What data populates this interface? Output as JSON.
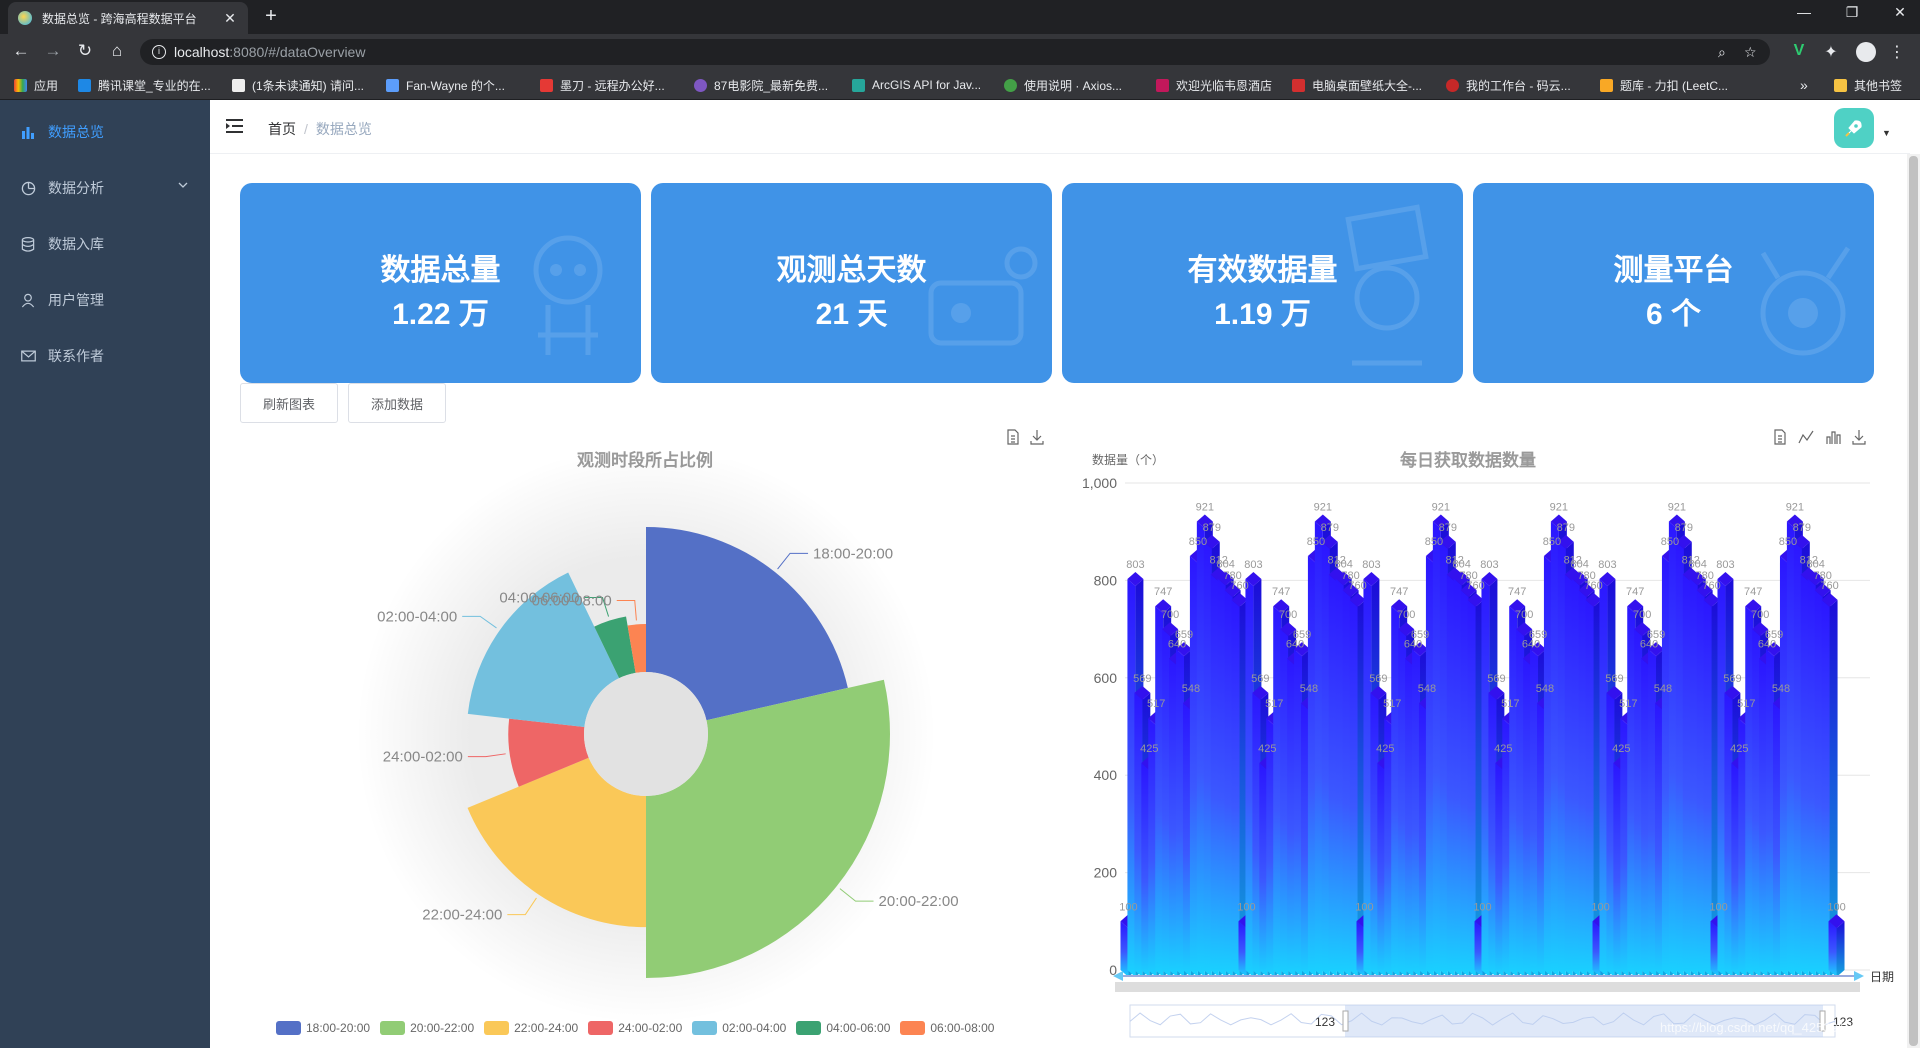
{
  "browser": {
    "tab_title": "数据总览 - 跨海高程数据平台",
    "tab_close": "✕",
    "new_tab": "+",
    "url_host": "localhost",
    "url_path": ":8080/#/dataOverview",
    "bookmarks": [
      {
        "label": "应用",
        "color": "#ea4335"
      },
      {
        "label": "腾讯课堂_专业的在...",
        "color": "#1e88e5"
      },
      {
        "label": "(1条未读通知) 请问...",
        "color": "#111111"
      },
      {
        "label": "Fan-Wayne 的个...",
        "color": "#5c9dfa"
      },
      {
        "label": "墨刀 - 远程办公好...",
        "color": "#e53935"
      },
      {
        "label": "87电影院_最新免费...",
        "color": "#7e57c2"
      },
      {
        "label": "ArcGIS API for Jav...",
        "color": "#26a69a"
      },
      {
        "label": "使用说明 · Axios...",
        "color": "#43a047"
      },
      {
        "label": "欢迎光临韦恩酒店",
        "color": "#c2185b"
      },
      {
        "label": "电脑桌面壁纸大全-...",
        "color": "#d32f2f"
      },
      {
        "label": "我的工作台 - 码云...",
        "color": "#c62828"
      },
      {
        "label": "题库 - 力扣 (LeetC...",
        "color": "#f9a825"
      }
    ],
    "bookmarks_more": "»",
    "other_bookmarks": "其他书签"
  },
  "sidebar": {
    "items": [
      {
        "label": "数据总览",
        "icon": "bar-chart-icon",
        "active": true
      },
      {
        "label": "数据分析",
        "icon": "pie-chart-icon",
        "has_submenu": true
      },
      {
        "label": "数据入库",
        "icon": "database-icon"
      },
      {
        "label": "用户管理",
        "icon": "user-icon"
      },
      {
        "label": "联系作者",
        "icon": "mail-icon"
      }
    ]
  },
  "breadcrumb": {
    "home": "首页",
    "separator": "/",
    "current": "数据总览"
  },
  "cards": [
    {
      "title": "数据总量",
      "value": "1.22 万"
    },
    {
      "title": "观测总天数",
      "value": "21 天"
    },
    {
      "title": "有效数据量",
      "value": "1.19 万"
    },
    {
      "title": "测量平台",
      "value": "6 个"
    }
  ],
  "buttons": {
    "refresh": "刷新图表",
    "add": "添加数据"
  },
  "colors": {
    "sidebar_bg": "#304156",
    "accent": "#409eff",
    "card_bg": "#4093e7"
  },
  "chart_data": [
    {
      "type": "pie",
      "variant": "rose",
      "title": "观测时段所占比例",
      "categories": [
        "18:00-20:00",
        "20:00-22:00",
        "22:00-24:00",
        "24:00-02:00",
        "02:00-04:00",
        "04:00-06:00",
        "06:00-08:00"
      ],
      "values": [
        24,
        32,
        21,
        9,
        18,
        5,
        3
      ],
      "colors": [
        "#5470c6",
        "#91cc75",
        "#fac858",
        "#ee6666",
        "#73c0de",
        "#3ba272",
        "#fc8452"
      ],
      "legend_position": "bottom"
    },
    {
      "type": "bar",
      "variant": "3d-gradient",
      "title": "每日获取数据数量",
      "ylabel": "数据量（个）",
      "xlabel": "日期",
      "ylim": [
        0,
        1000
      ],
      "yticks": [
        "0",
        "200",
        "400",
        "600",
        "800",
        "1,000"
      ],
      "grid": "horizontal",
      "series": [
        {
          "values": [
            100,
            803,
            569,
            425,
            517,
            747,
            700,
            640,
            659,
            548,
            850,
            921,
            879,
            812,
            804,
            780,
            760,
            100,
            803,
            569,
            425,
            517,
            747,
            700,
            640,
            659,
            548,
            850,
            921,
            879,
            812,
            804,
            780,
            760,
            100,
            803,
            569,
            425,
            517,
            747,
            700,
            640,
            659,
            548,
            850,
            921,
            879,
            812,
            804,
            780,
            760,
            100,
            803,
            569,
            425,
            517,
            747,
            700,
            640,
            659,
            548,
            850,
            921,
            879,
            812,
            804,
            780,
            760,
            100,
            803,
            569,
            425,
            517,
            747,
            700,
            640,
            659,
            548,
            850,
            921,
            879,
            812,
            804,
            780,
            760,
            100,
            803,
            569,
            425,
            517,
            747,
            700,
            640,
            659,
            548,
            850,
            921,
            879,
            812,
            804,
            780,
            760,
            100
          ]
        }
      ],
      "data_labels": [
        "803",
        "569",
        "425",
        "517",
        "747",
        "700",
        "640",
        "659",
        "548",
        "921",
        "804"
      ],
      "datazoom": {
        "start_label": "123",
        "end_label": "123"
      }
    }
  ],
  "watermark": "https://blog.csdn.net/qq_42539194"
}
